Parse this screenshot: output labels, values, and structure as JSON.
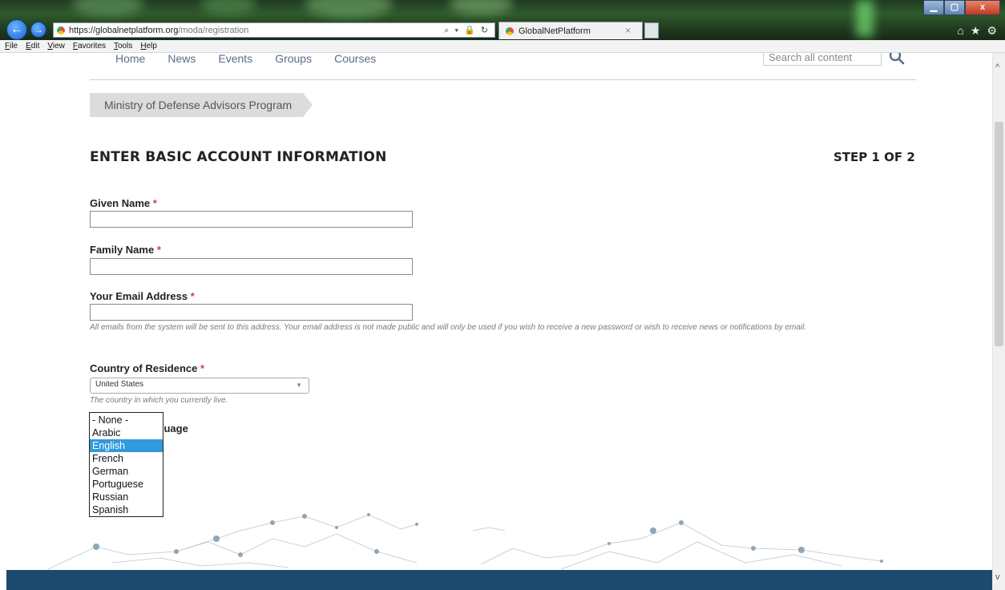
{
  "browser": {
    "url_host": "https://globalnetplatform.org",
    "url_path": "/moda/registration",
    "tab_title": "GlobalNetPlatform",
    "tab_close": "×",
    "menu": [
      "File",
      "Edit",
      "View",
      "Favorites",
      "Tools",
      "Help"
    ],
    "back_glyph": "←",
    "forward_glyph": "→",
    "addr_actions": "⌕ ▾ 🔒 ↻",
    "win_min": "▁",
    "win_max": "▢",
    "win_close": "x",
    "home_glyph": "⌂",
    "fav_glyph": "★",
    "settings_glyph": "⚙"
  },
  "site_nav": {
    "items": [
      "Home",
      "News",
      "Events",
      "Groups",
      "Courses"
    ],
    "search_placeholder": "Search all content"
  },
  "breadcrumb": "Ministry of Defense Advisors Program",
  "form": {
    "title": "ENTER BASIC ACCOUNT INFORMATION",
    "step": "STEP 1 OF 2",
    "required_mark": "*",
    "given_name_label": "Given Name",
    "given_name_value": "",
    "family_name_label": "Family Name",
    "family_name_value": "",
    "email_label": "Your Email Address",
    "email_value": "",
    "email_help": "All emails from the system will be sent to this address. Your email address is not made public and will only be used if you wish to receive a new password or wish to receive news or notifications by email.",
    "country_label": "Country of Residence",
    "country_value": "United States",
    "country_help": "The country in which you currently live.",
    "language_label_partial": "guage",
    "language_options": [
      "- None -",
      "Arabic",
      "English",
      "French",
      "German",
      "Portuguese",
      "Russian",
      "Spanish"
    ],
    "language_selected": "English"
  },
  "scrollbar": {
    "up_glyph": "^",
    "down_glyph": "v"
  },
  "colors": {
    "footer": "#1d4a6c",
    "selection": "#3399dd",
    "required": "#d64040",
    "nav_text": "#5a6e86"
  }
}
